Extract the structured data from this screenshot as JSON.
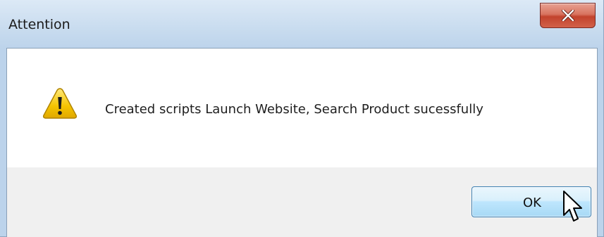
{
  "dialog": {
    "title": "Attention",
    "message": "Created scripts Launch Website, Search Product sucessfully",
    "icon": "warning-icon",
    "ok_label": "OK",
    "close_icon": "close-icon"
  },
  "colors": {
    "close_button": "#c7462f",
    "ok_button_border": "#3c7fb1",
    "warning_fill": "#f5c400"
  }
}
